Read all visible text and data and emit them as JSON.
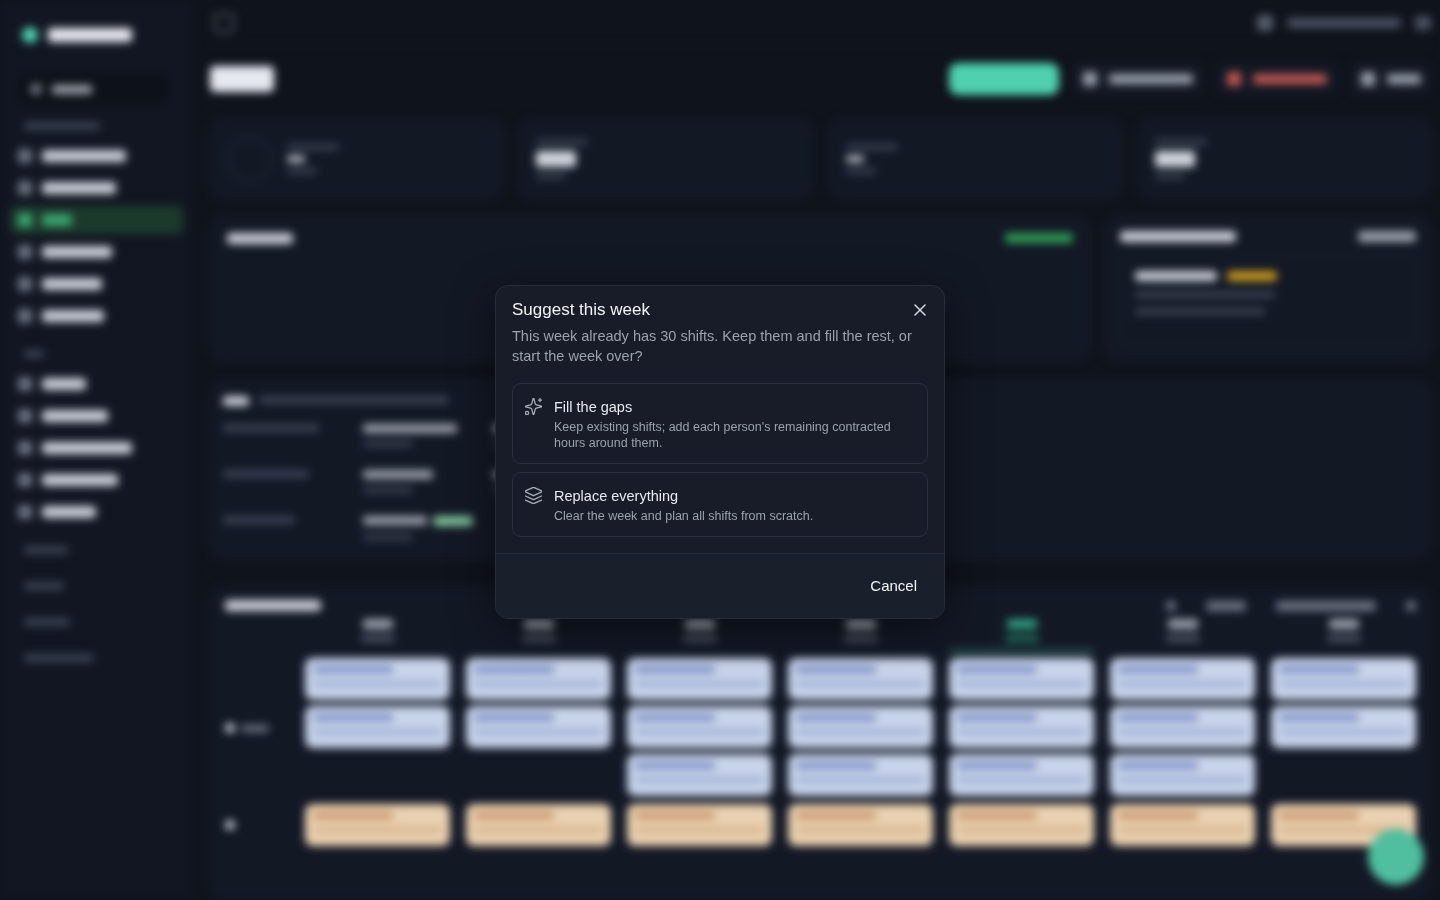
{
  "dialog": {
    "title": "Suggest this week",
    "message": "This week already has 30 shifts. Keep them and fill the rest, or start the week over?",
    "options": [
      {
        "kind": "fill",
        "title": "Fill the gaps",
        "description": "Keep existing shifts; add each person's remaining contracted hours around them."
      },
      {
        "kind": "replace",
        "title": "Replace everything",
        "description": "Clear the week and plan all shifts from scratch."
      }
    ],
    "buttons": [
      "Cancel"
    ]
  }
}
